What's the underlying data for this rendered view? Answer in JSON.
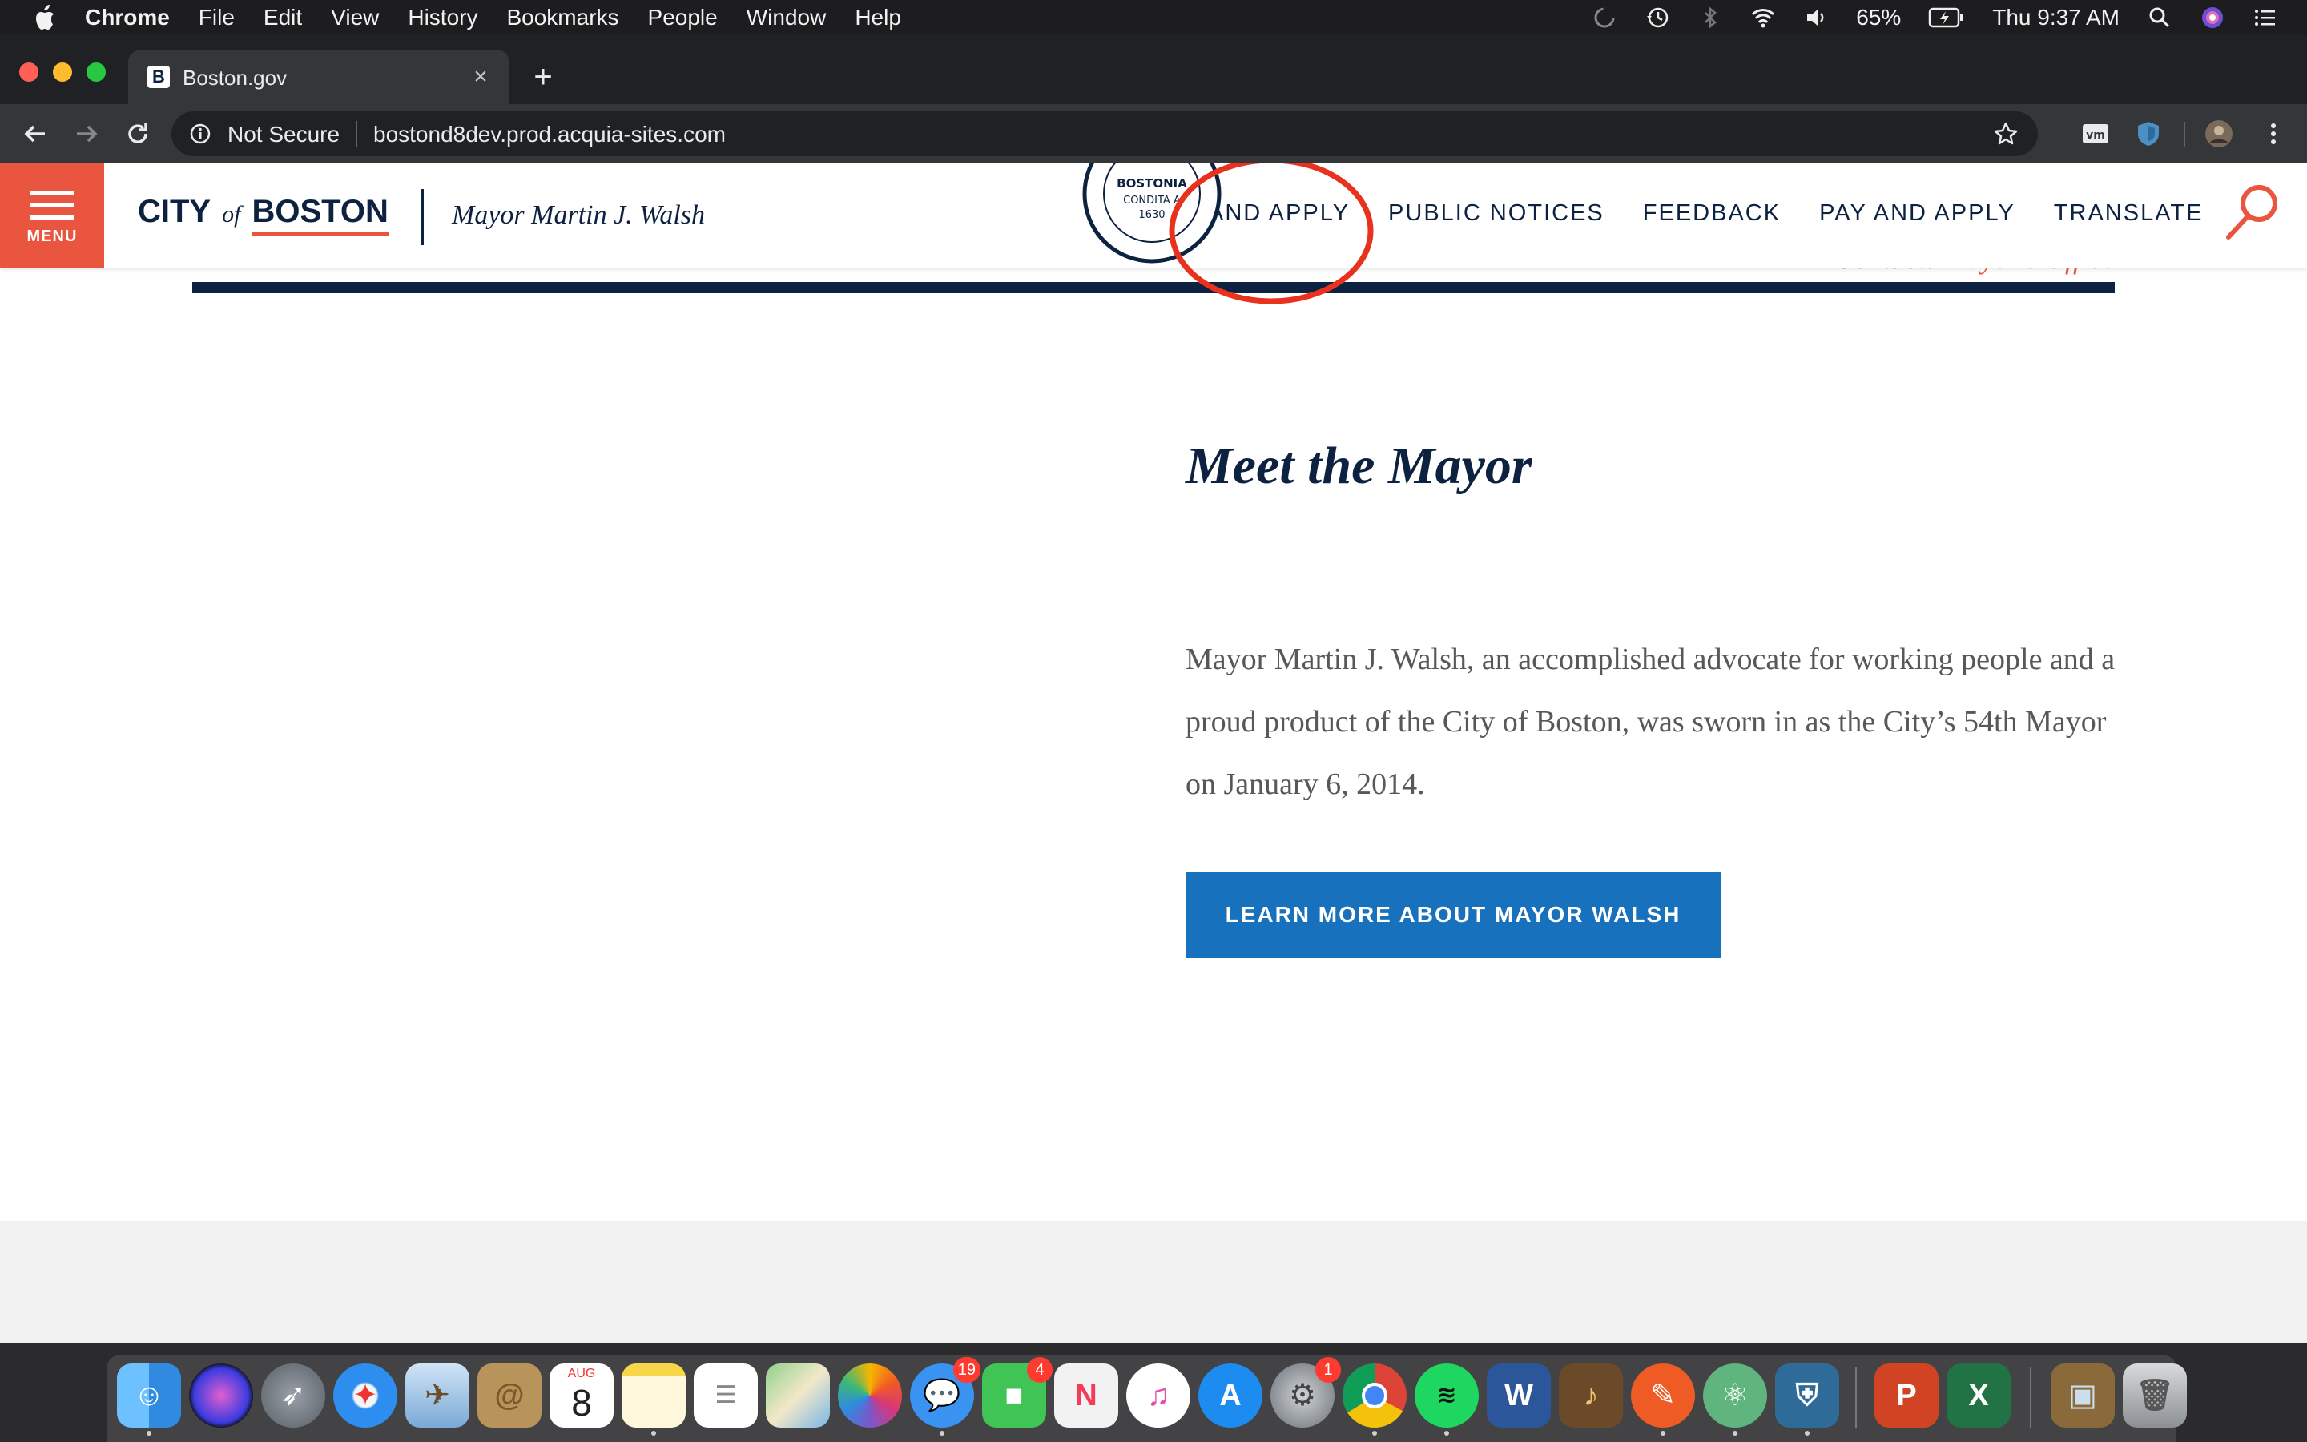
{
  "menubar": {
    "app_name": "Chrome",
    "menus": [
      "File",
      "Edit",
      "View",
      "History",
      "Bookmarks",
      "People",
      "Window",
      "Help"
    ],
    "battery": "65%",
    "clock": "Thu 9:37 AM"
  },
  "browser": {
    "tab_title": "Boston.gov",
    "tab_favicon": "B",
    "security_label": "Not Secure",
    "url": "bostond8dev.prod.acquia-sites.com"
  },
  "site": {
    "logo_city": "CITY",
    "logo_of": "of",
    "logo_boston": "BOSTON",
    "mayor_name": "Mayor Martin J. Walsh",
    "menu_label": "MENU",
    "seal_text_top": "BOSTONIA",
    "seal_text_mid": "CONDITA A",
    "seal_year": "1630",
    "nav": [
      "AND APPLY",
      "PUBLIC NOTICES",
      "FEEDBACK",
      "PAY AND APPLY",
      "TRANSLATE"
    ],
    "contact_prefix": "Contact:",
    "contact_link": "Mayor's Office",
    "section_title": "Meet the Mayor",
    "intro": "Mayor Martin J. Walsh, an accomplished advocate for working people and a proud product of the City of Boston, was sworn in as the City’s 54th Mayor on January 6, 2014.",
    "cta": "LEARN MORE ABOUT MAYOR WALSH"
  },
  "colors": {
    "brand_navy": "#0d2240",
    "brand_red": "#e9553f",
    "cta_blue": "#1871bd",
    "annotation_red": "#e8321e"
  },
  "dock": {
    "calendar_month": "AUG",
    "calendar_day": "8",
    "messages_badge": "19",
    "facetime_badge": "4",
    "system_prefs_badge": "1",
    "items": [
      "finder-icon",
      "siri-icon",
      "launchpad-icon",
      "safari-icon",
      "mail-icon",
      "contacts-icon",
      "calendar-icon",
      "notes-icon",
      "reminders-icon",
      "maps-icon",
      "photos-icon",
      "messages-icon",
      "facetime-icon",
      "news-icon",
      "itunes-icon",
      "app-store-icon",
      "system-preferences-icon",
      "chrome-icon",
      "spotify-icon",
      "word-icon",
      "garageband-icon",
      "postman-icon",
      "atom-icon",
      "vpn-icon",
      "powerpoint-icon",
      "excel-icon",
      "archive-utility-icon",
      "trash-icon"
    ]
  }
}
